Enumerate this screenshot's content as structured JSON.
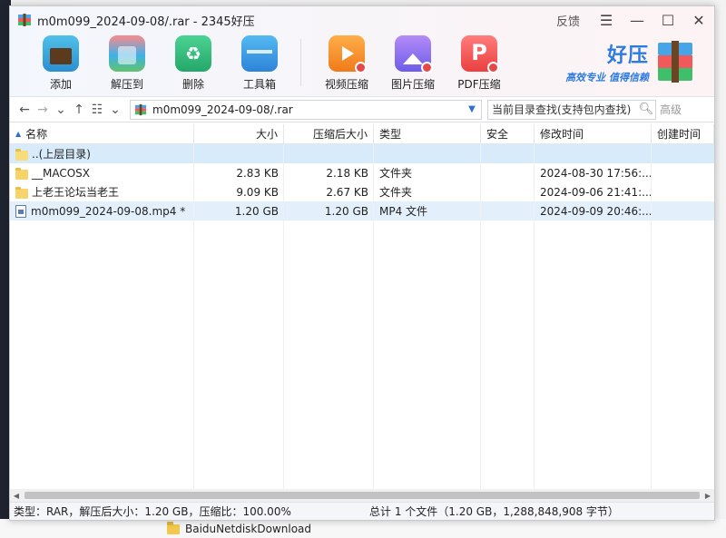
{
  "window": {
    "title": "m0m099_2024-09-08/.rar - 2345好压",
    "feedback_label": "反馈"
  },
  "toolbar": {
    "add_label": "添加",
    "extract_label": "解压到",
    "delete_label": "删除",
    "tools_label": "工具箱",
    "video_compress_label": "视频压缩",
    "image_compress_label": "图片压缩",
    "pdf_compress_label": "PDF压缩"
  },
  "brand": {
    "name": "好压",
    "slogan": "高效专业 值得信赖"
  },
  "nav": {
    "path": "m0m099_2024-09-08/.rar",
    "search_placeholder": "当前目录查找(支持包内查找)",
    "advanced_label": "高级"
  },
  "columns": {
    "name": "名称",
    "size": "大小",
    "compressed_size": "压缩后大小",
    "type": "类型",
    "security": "安全",
    "modified": "修改时间",
    "created": "创建时间"
  },
  "rows": [
    {
      "name": "..(上层目录)",
      "size": "",
      "compressed": "",
      "type": "",
      "security": "",
      "modified": "",
      "created": ""
    },
    {
      "name": "__MACOSX",
      "size": "2.83 KB",
      "compressed": "2.18 KB",
      "type": "文件夹",
      "security": "",
      "modified": "2024-08-30 17:56:...",
      "created": ""
    },
    {
      "name": "上老王论坛当老王",
      "size": "9.09 KB",
      "compressed": "2.67 KB",
      "type": "文件夹",
      "security": "",
      "modified": "2024-09-06 21:41:...",
      "created": ""
    },
    {
      "name": "m0m099_2024-09-08.mp4 *",
      "size": "1.20 GB",
      "compressed": "1.20 GB",
      "type": "MP4 文件",
      "security": "",
      "modified": "2024-09-09 20:46:...",
      "created": ""
    }
  ],
  "status": {
    "left": "类型：RAR，解压后大小：1.20 GB，压缩比：100.00%",
    "right": "总计 1 个文件（1.20 GB，1,288,848,908 字节）"
  },
  "background": {
    "folder_label": "BaiduNetdiskDownload"
  }
}
